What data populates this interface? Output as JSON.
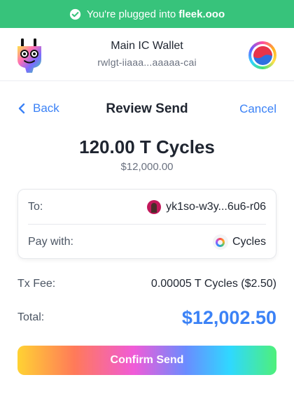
{
  "banner": {
    "prefix": "You're plugged into",
    "site": "fleek.ooo",
    "color": "#37c37b"
  },
  "header": {
    "wallet_name": "Main IC Wallet",
    "wallet_id": "rwlgt-iiaaa...aaaaa-cai",
    "logo_icon": "plug-logo-icon",
    "avatar_icon": "profile-avatar-icon"
  },
  "nav": {
    "back_label": "Back",
    "title": "Review Send",
    "cancel_label": "Cancel"
  },
  "amount": {
    "value": "120.00 T Cycles",
    "usd": "$12,000.00"
  },
  "details": {
    "to_label": "To:",
    "to_value": "yk1so-w3y...6u6-r06",
    "pay_label": "Pay with:",
    "pay_value": "Cycles"
  },
  "fee": {
    "label": "Tx Fee:",
    "value": "0.00005 T Cycles ($2.50)"
  },
  "total": {
    "label": "Total:",
    "value": "$12,002.50"
  },
  "confirm_label": "Confirm Send",
  "colors": {
    "accent": "#3b82f6",
    "text": "#1f2530",
    "muted": "#6b7280"
  }
}
